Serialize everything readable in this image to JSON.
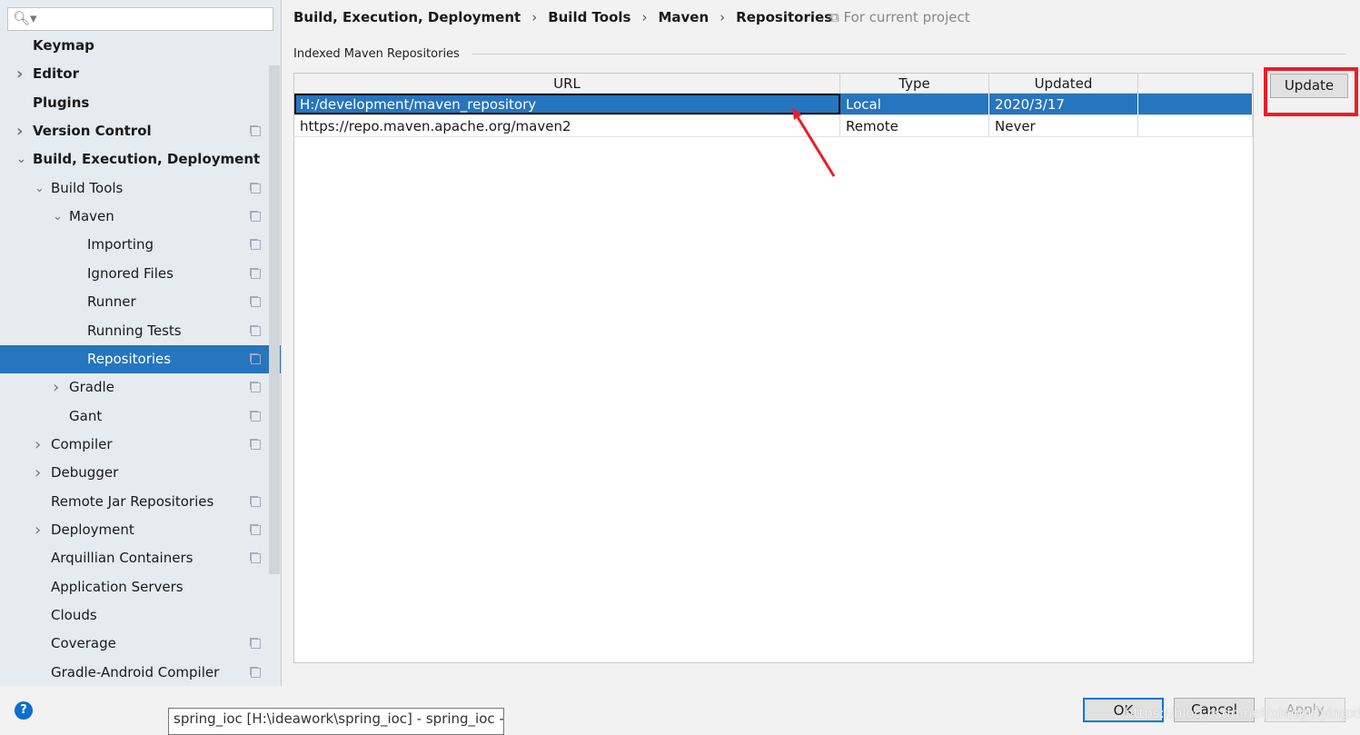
{
  "sidebar": {
    "search_placeholder": "",
    "items": [
      {
        "label": "Keymap",
        "level": 0,
        "bold": true,
        "arrow": "",
        "copy": false
      },
      {
        "label": "Editor",
        "level": 0,
        "bold": true,
        "arrow": "right",
        "copy": false
      },
      {
        "label": "Plugins",
        "level": 0,
        "bold": true,
        "arrow": "",
        "copy": false
      },
      {
        "label": "Version Control",
        "level": 0,
        "bold": true,
        "arrow": "right",
        "copy": true
      },
      {
        "label": "Build, Execution, Deployment",
        "level": 0,
        "bold": true,
        "arrow": "down",
        "copy": false
      },
      {
        "label": "Build Tools",
        "level": 1,
        "arrow": "down",
        "copy": true
      },
      {
        "label": "Maven",
        "level": 2,
        "arrow": "down",
        "copy": true
      },
      {
        "label": "Importing",
        "level": 3,
        "arrow": "",
        "copy": true
      },
      {
        "label": "Ignored Files",
        "level": 3,
        "arrow": "",
        "copy": true
      },
      {
        "label": "Runner",
        "level": 3,
        "arrow": "",
        "copy": true
      },
      {
        "label": "Running Tests",
        "level": 3,
        "arrow": "",
        "copy": true
      },
      {
        "label": "Repositories",
        "level": 3,
        "arrow": "",
        "copy": true,
        "selected": true
      },
      {
        "label": "Gradle",
        "level": 2,
        "arrow": "right",
        "copy": true
      },
      {
        "label": "Gant",
        "level": 2,
        "arrow": "",
        "copy": true
      },
      {
        "label": "Compiler",
        "level": 1,
        "arrow": "right",
        "copy": true
      },
      {
        "label": "Debugger",
        "level": 1,
        "arrow": "right",
        "copy": false
      },
      {
        "label": "Remote Jar Repositories",
        "level": 1,
        "arrow": "",
        "copy": true
      },
      {
        "label": "Deployment",
        "level": 1,
        "arrow": "right",
        "copy": true
      },
      {
        "label": "Arquillian Containers",
        "level": 1,
        "arrow": "",
        "copy": true
      },
      {
        "label": "Application Servers",
        "level": 1,
        "arrow": "",
        "copy": false
      },
      {
        "label": "Clouds",
        "level": 1,
        "arrow": "",
        "copy": false
      },
      {
        "label": "Coverage",
        "level": 1,
        "arrow": "",
        "copy": true
      },
      {
        "label": "Gradle-Android Compiler",
        "level": 1,
        "arrow": "",
        "copy": true
      }
    ]
  },
  "breadcrumb": [
    "Build, Execution, Deployment",
    "Build Tools",
    "Maven",
    "Repositories"
  ],
  "scope_label": "For current project",
  "group_title": "Indexed Maven Repositories",
  "table": {
    "columns": [
      "URL",
      "Type",
      "Updated",
      ""
    ],
    "rows": [
      [
        "H:/development/maven_repository",
        "Local",
        "2020/3/17",
        ""
      ],
      [
        "https://repo.maven.apache.org/maven2",
        "Remote",
        "Never",
        ""
      ]
    ]
  },
  "update_label": "Update",
  "footer": {
    "ok": "OK",
    "cancel": "Cancel",
    "apply": "Apply",
    "help": "?"
  },
  "tooltip": "spring_ioc [H:\\ideawork\\spring_ioc] - spring_ioc - ...",
  "watermark": "https://blog.csdn.net/xiaoguiyingxia",
  "colors": {
    "selection": "#2675bf",
    "annotation": "#ee1c25"
  }
}
